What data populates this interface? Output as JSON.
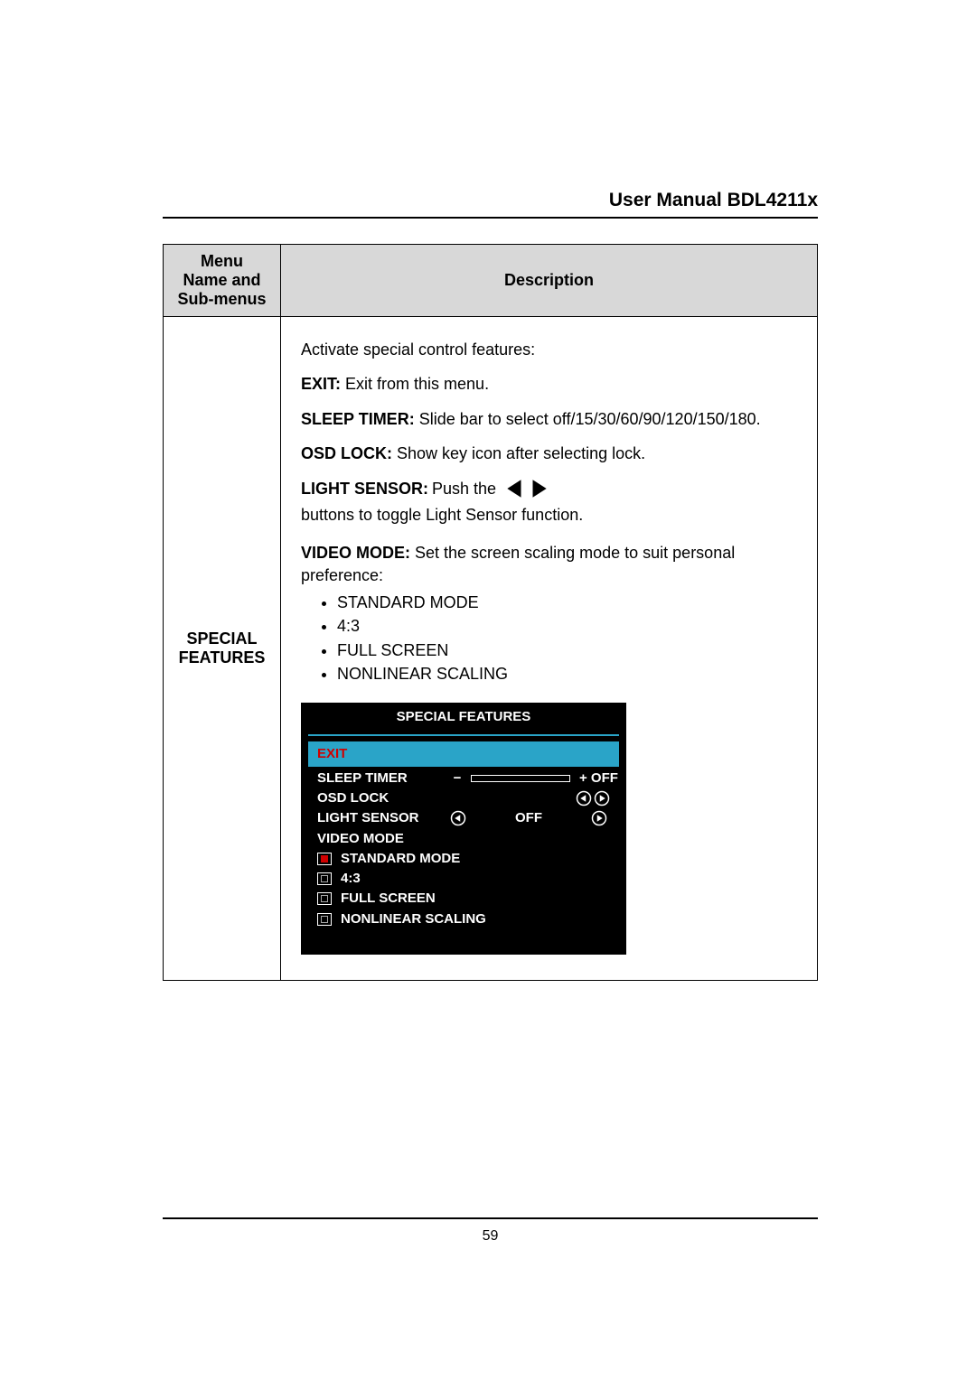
{
  "header": {
    "title": "User Manual BDL4211x"
  },
  "table": {
    "col1_header_line1": "Menu",
    "col1_header_line2": "Name and",
    "col1_header_line3": "Sub-menus",
    "col2_header": "Description",
    "menu_name_line1": "SPECIAL",
    "menu_name_line2": "FEATURES"
  },
  "desc": {
    "intro": "Activate special control features:",
    "exit_label": "EXIT:",
    "exit_text": " Exit from this menu.",
    "sleep_label": "SLEEP TIMER:",
    "sleep_text": " Slide bar to select off/15/30/60/90/120/150/180.",
    "osdlock_label": "OSD LOCK:",
    "osdlock_text": " Show key icon after selecting lock.",
    "light_label": "LIGHT SENSOR:",
    "light_text_pre": " Push the ",
    "light_text_post": " buttons to toggle Light Sensor function.",
    "video_label": "VIDEO MODE:",
    "video_text": " Set the screen scaling mode to suit personal preference:",
    "bullets": [
      "STANDARD MODE",
      "4:3",
      "FULL SCREEN",
      "NONLINEAR SCALING"
    ]
  },
  "osd": {
    "title": "SPECIAL FEATURES",
    "exit": "EXIT",
    "sleep_label": "SLEEP TIMER",
    "sleep_minus": "−",
    "sleep_plus": "+ OFF",
    "lock_label": "OSD LOCK",
    "light_label": "LIGHT SENSOR",
    "light_value": "OFF",
    "video_label": "VIDEO MODE",
    "modes": {
      "standard": "STANDARD MODE",
      "ratio": "4:3",
      "full": "FULL SCREEN",
      "nonlinear": "NONLINEAR SCALING"
    }
  },
  "footer": {
    "page": "59"
  }
}
